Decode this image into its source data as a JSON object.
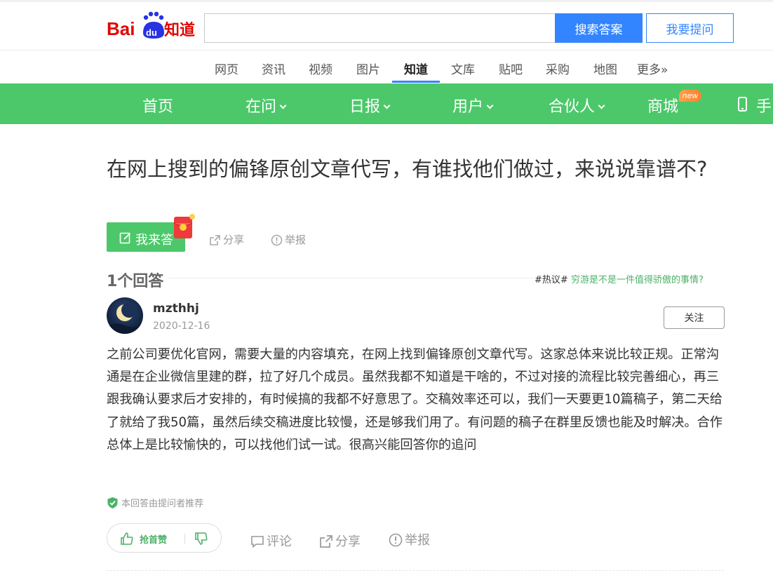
{
  "header": {
    "logo_text": "Bai du 知道",
    "search_value": "",
    "search_button": "搜索答案",
    "ask_button": "我要提问"
  },
  "channels": [
    {
      "label": "网页",
      "active": false
    },
    {
      "label": "资讯",
      "active": false
    },
    {
      "label": "视频",
      "active": false
    },
    {
      "label": "图片",
      "active": false
    },
    {
      "label": "知道",
      "active": true
    },
    {
      "label": "文库",
      "active": false
    },
    {
      "label": "贴吧",
      "active": false
    },
    {
      "label": "采购",
      "active": false
    },
    {
      "label": "地图",
      "active": false
    },
    {
      "label": "更多»",
      "active": false
    }
  ],
  "green_nav": {
    "home": "首页",
    "asking": "在问",
    "daily": "日报",
    "users": "用户",
    "partners": "合伙人",
    "mall": "商城",
    "mall_badge": "new",
    "mobile": "手"
  },
  "question": {
    "title": "在网上搜到的偏锋原创文章代写，有谁找他们做过，来说说靠谱不?",
    "answer_button": "我来答",
    "share": "分享",
    "report": "举报"
  },
  "answers_header": {
    "count": "1个回答",
    "hot_tag": "#热议#",
    "hot_link": "穷游是不是一件值得骄傲的事情?"
  },
  "answer": {
    "username": "mzthhj",
    "date": "2020-12-16",
    "follow": "关注",
    "body": "之前公司要优化官网，需要大量的内容填充，在网上找到偏锋原创文章代写。这家总体来说比较正规。正常沟通是在企业微信里建的群，拉了好几个成员。虽然我都不知道是干啥的，不过对接的流程比较完善细心，再三跟我确认要求后才安排的，有时候搞的我都不好意思了。交稿效率还可以，我们一天要更10篇稿子，第二天给了就给了我50篇，虽然后续交稿进度比较慢，还是够我们用了。有问题的稿子在群里反馈也能及时解决。合作总体上是比较愉快的，可以找他们试一试。很高兴能回答你的追问",
    "recommend": "本回答由提问者推荐",
    "upvote": "抢首赞",
    "comment": "评论",
    "share": "分享",
    "report": "举报"
  },
  "colors": {
    "brand_green": "#4cc86a",
    "brand_blue": "#3385ff",
    "link_green": "#4cb268"
  }
}
